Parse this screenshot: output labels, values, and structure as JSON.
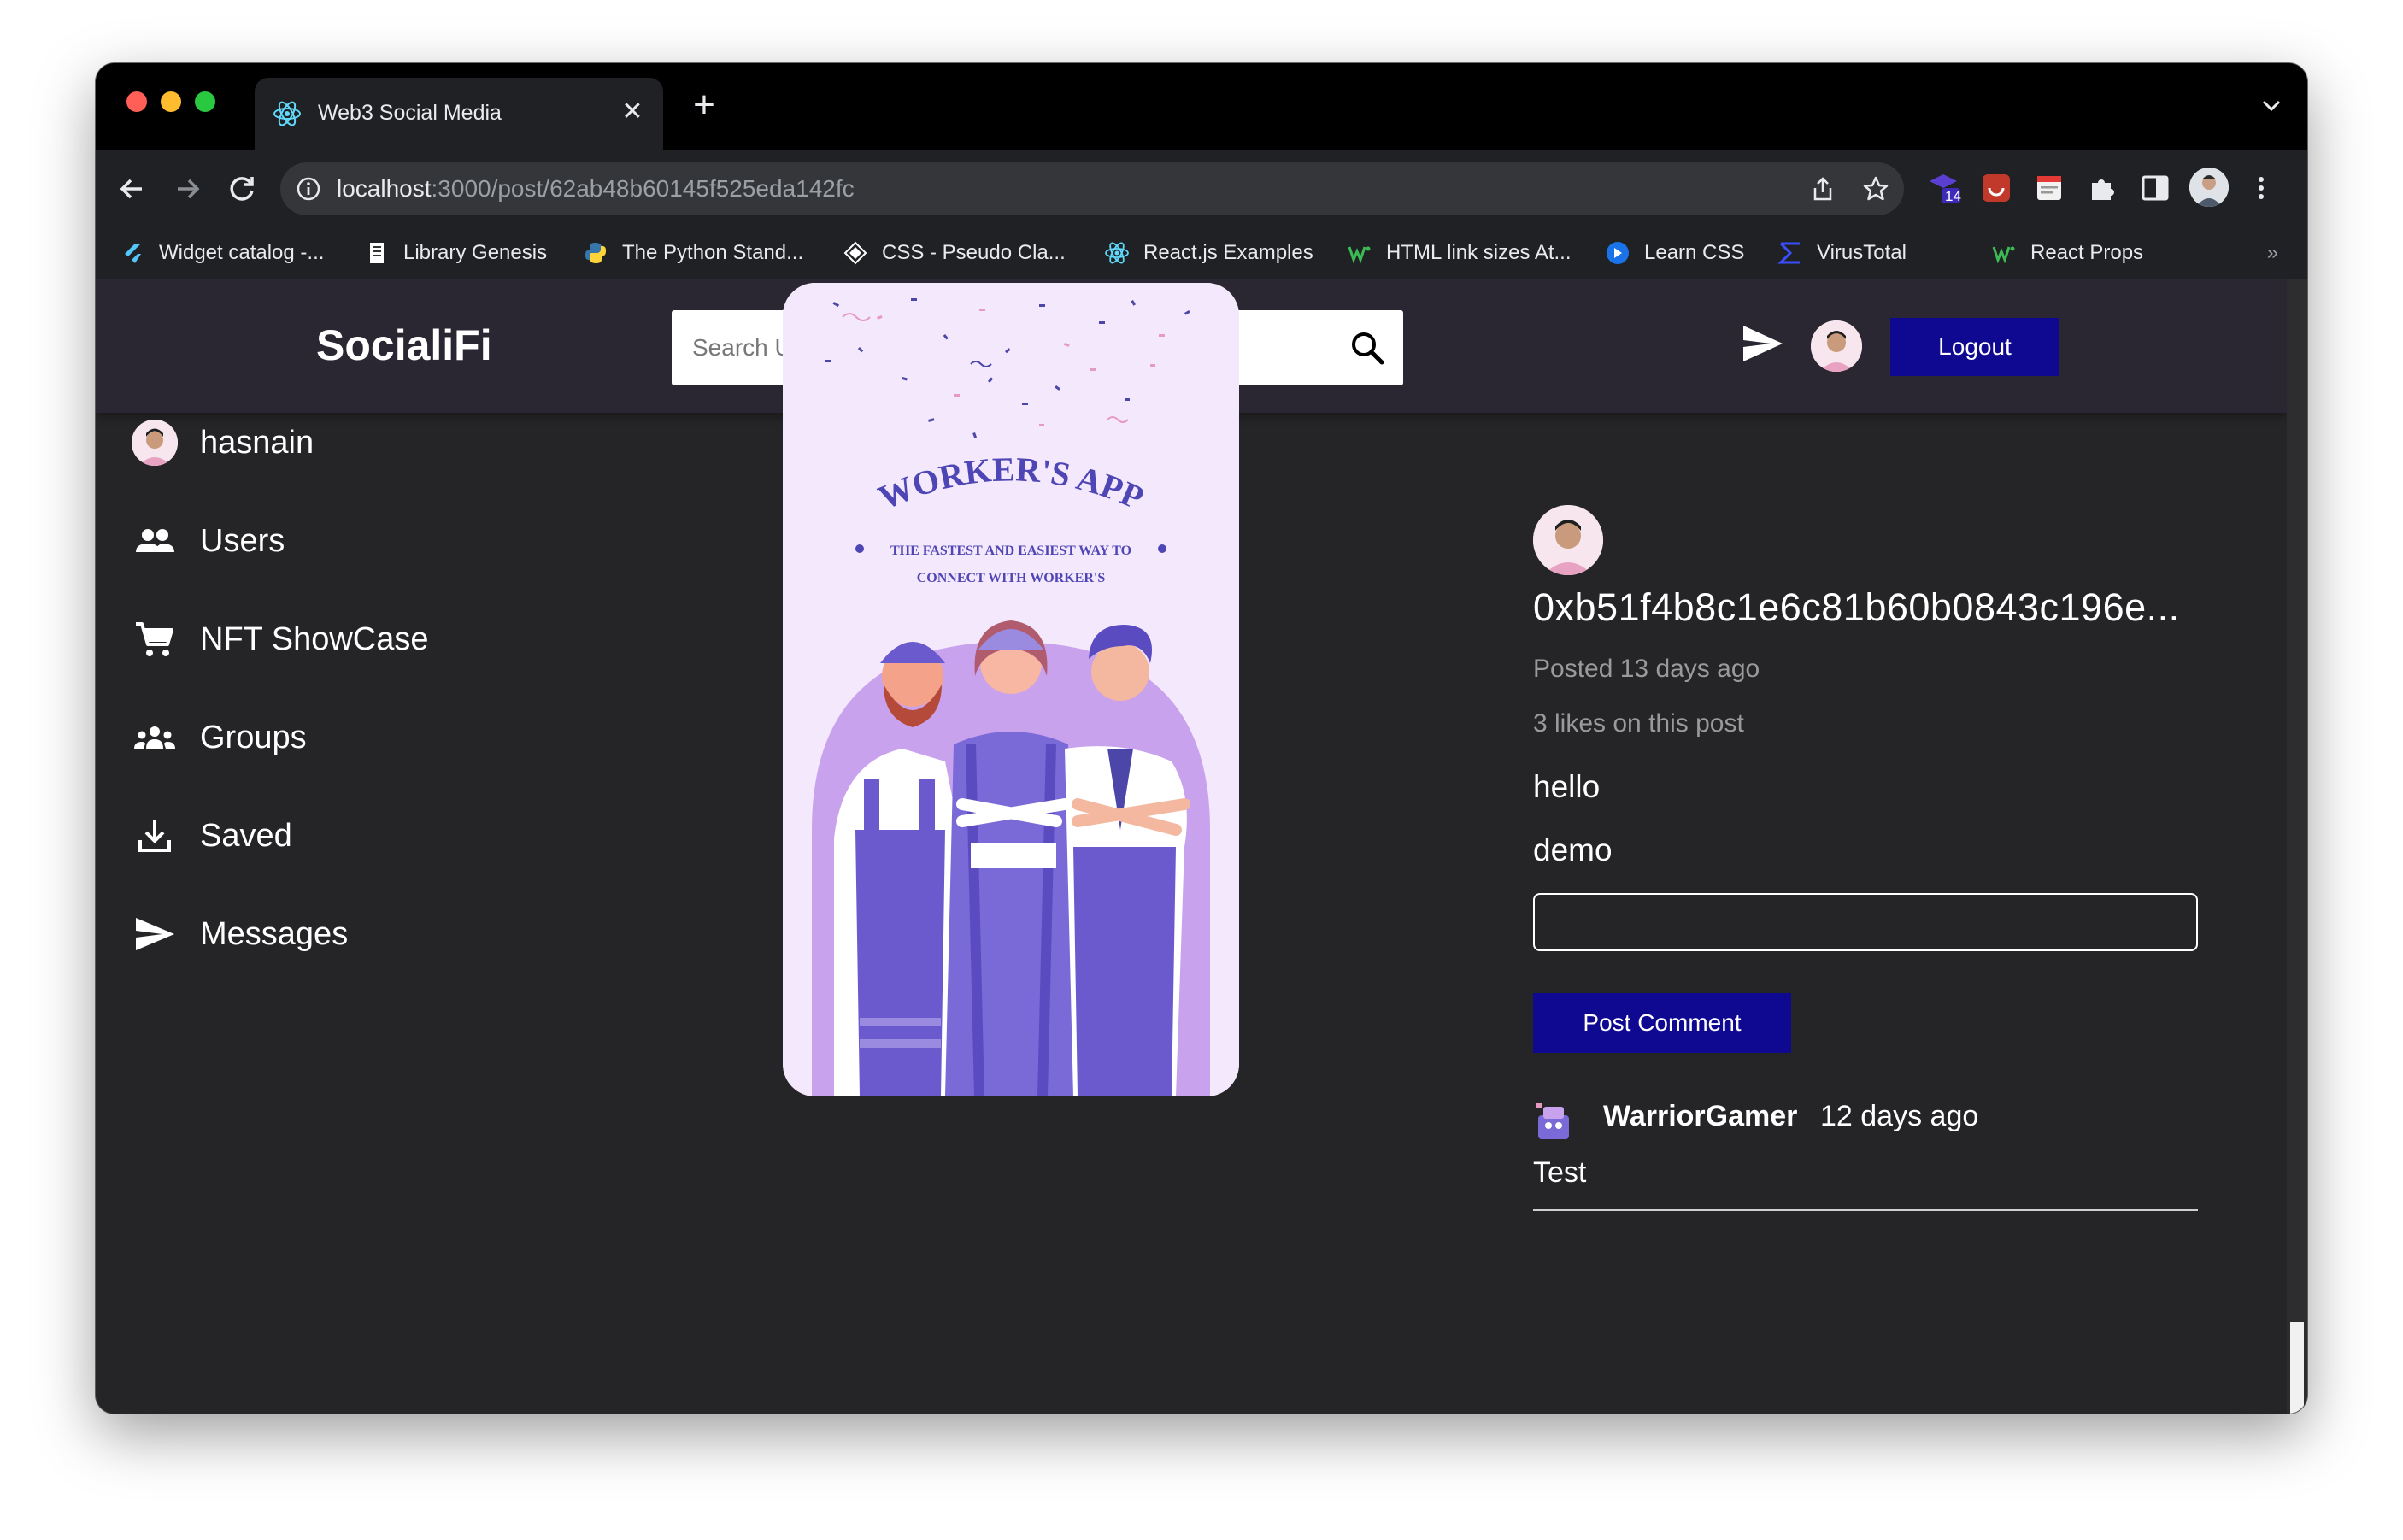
{
  "browser": {
    "tab_title": "Web3 Social Media",
    "url_host": "localhost",
    "url_path": ":3000/post/62ab48b60145f525eda142fc",
    "extension_badge": "14",
    "bookmarks": [
      {
        "label": "Widget catalog -...",
        "icon": "flutter-icon",
        "color": "#54c5f8"
      },
      {
        "label": "Library Genesis",
        "icon": "book-icon",
        "color": "#ffffff"
      },
      {
        "label": "The Python Stand...",
        "icon": "python-icon",
        "color": "#ffd43b"
      },
      {
        "label": "CSS - Pseudo Cla...",
        "icon": "diamond-icon",
        "color": "#ffffff"
      },
      {
        "label": "React.js Examples",
        "icon": "react-icon",
        "color": "#61dafb"
      },
      {
        "label": "HTML link sizes At...",
        "icon": "w-icon",
        "color": "#3cba54"
      },
      {
        "label": "Learn CSS",
        "icon": "learn-icon",
        "color": "#1a73e8"
      },
      {
        "label": "VirusTotal",
        "icon": "sigma-icon",
        "color": "#394eff"
      },
      {
        "label": "React Props",
        "icon": "w-icon",
        "color": "#3cba54"
      }
    ]
  },
  "header": {
    "logo": "SocialiFi",
    "search_placeholder": "Search User",
    "logout_label": "Logout"
  },
  "sidebar": {
    "items": [
      {
        "label": "hasnain",
        "icon": "user-avatar"
      },
      {
        "label": "Users",
        "icon": "people-icon"
      },
      {
        "label": "NFT ShowCase",
        "icon": "cart-icon"
      },
      {
        "label": "Groups",
        "icon": "groups-icon"
      },
      {
        "label": "Saved",
        "icon": "download-icon"
      },
      {
        "label": "Messages",
        "icon": "send-icon"
      }
    ]
  },
  "post": {
    "image": {
      "title": "WORKER'S APP",
      "subtitle_line1": "THE FASTEST AND EASIEST WAY TO",
      "subtitle_line2": "CONNECT WITH WORKER'S"
    },
    "owner_address": "0xb51f4b8c1e6c81b60b0843c196e...",
    "posted": "Posted 13 days ago",
    "likes": "3 likes on this post",
    "title": "hello",
    "description": "demo",
    "comment_placeholder": "",
    "post_comment_label": "Post Comment",
    "comments": [
      {
        "user": "WarriorGamer",
        "time": "12 days ago",
        "text": "Test"
      }
    ]
  },
  "colors": {
    "page_bg": "#252527",
    "header_bg": "#2b2732",
    "button_blue": "#0f0891",
    "illustration_purple": "#6a5acd"
  }
}
